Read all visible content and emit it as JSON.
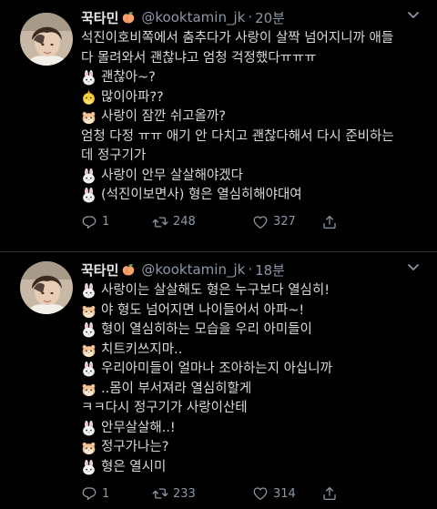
{
  "tweets": [
    {
      "name": "꾹타민",
      "handle": "@kooktamin_jk",
      "dot": "·",
      "time": "20분",
      "lines": [
        {
          "emoji": "",
          "text": "석진이호비쪽에서 춤추다가 사랑이 살짝 넘어지니까 애들"
        },
        {
          "emoji": "",
          "text": "다 몰려와서 괜찮냐고 엄청 걱정했다ㅠㅠㅠ"
        },
        {
          "emoji": "rabbit-icon",
          "text": "괜찮아~?"
        },
        {
          "emoji": "chick-icon",
          "text": "많이아파??"
        },
        {
          "emoji": "hamster-icon",
          "text": "사랑이 잠깐 쉬고올까?"
        },
        {
          "emoji": "",
          "text": "엄청 다정 ㅠㅠ 애기 안 다치고 괜찮다해서 다시 준비하는"
        },
        {
          "emoji": "",
          "text": "데 정구기가"
        },
        {
          "emoji": "rabbit-icon",
          "text": "사랑이 안무 살살해야겠다"
        },
        {
          "emoji": "rabbit-icon",
          "text": "(석진이보면사) 형은 열심히해야대여"
        }
      ],
      "replies": "1",
      "retweets": "248",
      "likes": "327"
    },
    {
      "name": "꾹타민",
      "handle": "@kooktamin_jk",
      "dot": "·",
      "time": "18분",
      "lines": [
        {
          "emoji": "rabbit-icon",
          "text": "사랑이는 살살해도 형은 누구보다 열심히!"
        },
        {
          "emoji": "hamster-icon",
          "text": "야 형도 넘어지면 나이들어서 아파~!"
        },
        {
          "emoji": "rabbit-icon",
          "text": "형이 열심히하는 모습을 우리 아미들이"
        },
        {
          "emoji": "hamster-icon",
          "text": "치트키쓰지마.."
        },
        {
          "emoji": "rabbit-icon",
          "text": "우리아미들이 얼마나 조아하는지 아십니까"
        },
        {
          "emoji": "hamster-icon",
          "text": "..몸이 부서져라 열심히할게"
        },
        {
          "emoji": "",
          "text": "ㅋㅋ다시 정구기가 사랑이산테"
        },
        {
          "emoji": "rabbit-icon",
          "text": "안무살살해..!"
        },
        {
          "emoji": "hamster-icon",
          "text": "정구가나는?"
        },
        {
          "emoji": "rabbit-icon",
          "text": "형은 열시미"
        }
      ],
      "replies": "1",
      "retweets": "233",
      "likes": "314"
    }
  ],
  "colors": {
    "background": "#000000",
    "text": "#d9d9d9",
    "secondary": "#8b98a5"
  }
}
